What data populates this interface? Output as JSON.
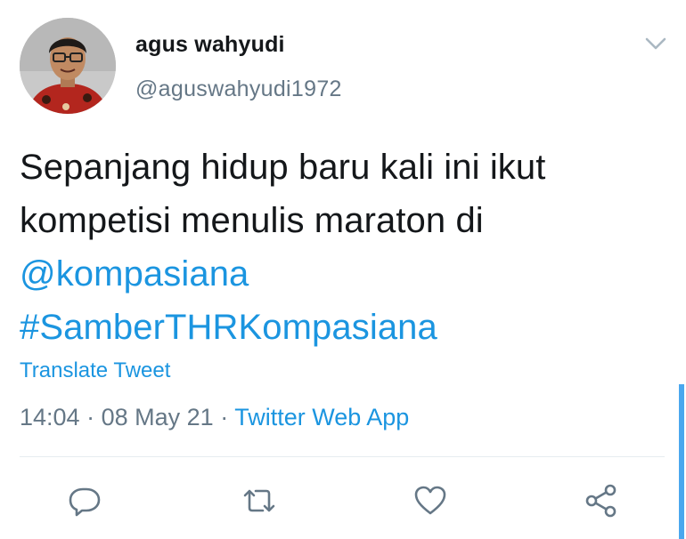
{
  "user": {
    "display_name": "agus wahyudi",
    "handle": "@aguswahyudi1972"
  },
  "tweet": {
    "text_line1": "Sepanjang hidup baru kali ini ikut",
    "text_line2": "kompetisi menulis maraton di",
    "mention": "@kompasiana",
    "hashtag": "#SamberTHRKompasiana",
    "translate_label": "Translate Tweet",
    "time": "14:04",
    "date": "08 May 21",
    "separator": "·",
    "source": "Twitter Web App"
  },
  "actions": {
    "reply": "reply-icon",
    "retweet": "retweet-icon",
    "like": "heart-icon",
    "share": "share-icon"
  },
  "colors": {
    "link": "#1b95e0",
    "text": "#14171a",
    "secondary": "#657786",
    "divider": "#e6ecf0"
  }
}
